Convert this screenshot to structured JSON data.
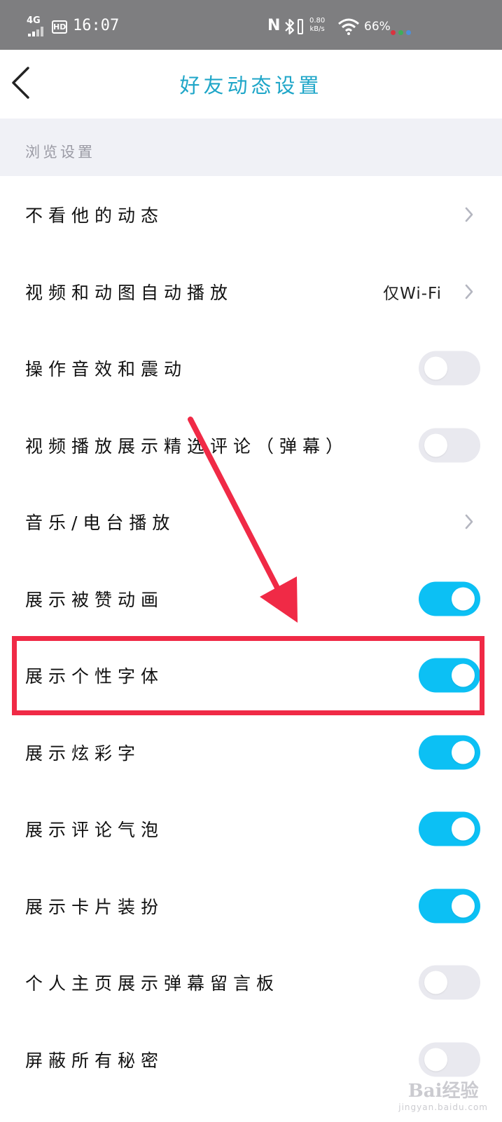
{
  "status_bar": {
    "network": "4G",
    "hd": "HD",
    "time": "16:07",
    "nfc": "N",
    "speed_value": "0.80",
    "speed_unit": "kB/s",
    "battery": "66%",
    "dot_colors": [
      "#d9333f",
      "#3fae5a",
      "#4f8fd9"
    ]
  },
  "header": {
    "title": "好友动态设置"
  },
  "section": {
    "title": "浏览设置"
  },
  "rows": [
    {
      "label": "不看他的动态",
      "type": "link"
    },
    {
      "label": "视频和动图自动播放",
      "type": "link",
      "value": "仅Wi-Fi"
    },
    {
      "label": "操作音效和震动",
      "type": "toggle",
      "on": false
    },
    {
      "label": "视频播放展示精选评论（弹幕）",
      "type": "toggle",
      "on": false
    },
    {
      "label": "音乐/电台播放",
      "type": "link"
    },
    {
      "label": "展示被赞动画",
      "type": "toggle",
      "on": true
    },
    {
      "label": "展示个性字体",
      "type": "toggle",
      "on": true,
      "highlighted": true
    },
    {
      "label": "展示炫彩字",
      "type": "toggle",
      "on": true
    },
    {
      "label": "展示评论气泡",
      "type": "toggle",
      "on": true
    },
    {
      "label": "展示卡片装扮",
      "type": "toggle",
      "on": true
    },
    {
      "label": "个人主页展示弹幕留言板",
      "type": "toggle",
      "on": false
    },
    {
      "label": "屏蔽所有秘密",
      "type": "toggle",
      "on": false
    }
  ],
  "colors": {
    "accent": "#0cc0f4",
    "title": "#1fa6c8",
    "annotation": "#f02a46"
  },
  "watermark": {
    "main": "Bai经验",
    "sub": "jingyan.baidu.com"
  }
}
